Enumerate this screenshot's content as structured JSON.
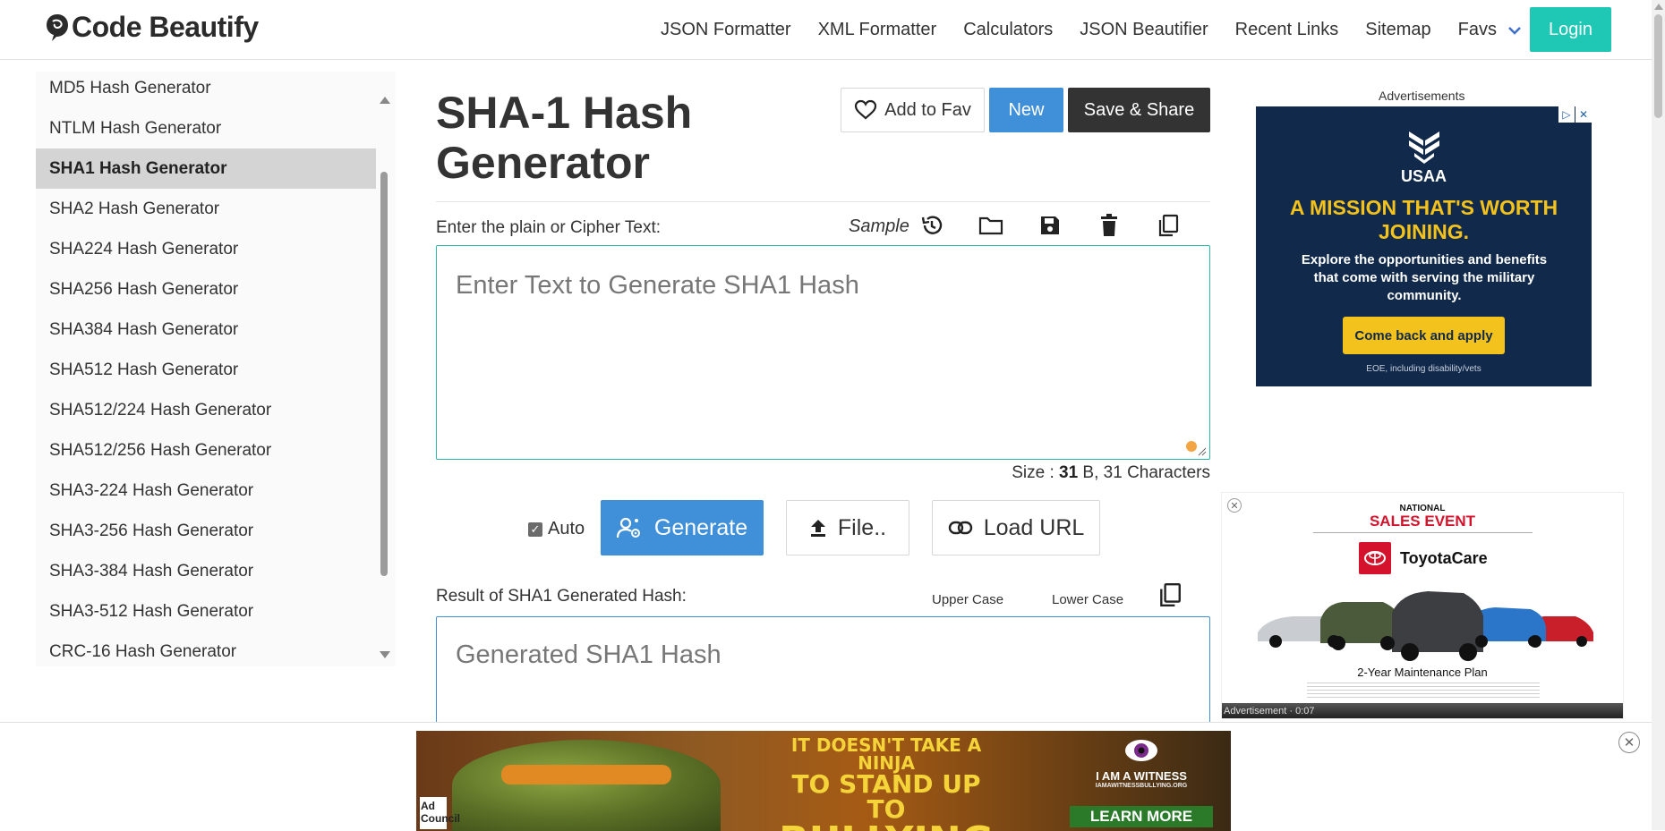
{
  "header": {
    "logo_text": "Code Beautify",
    "nav": [
      "JSON Formatter",
      "XML Formatter",
      "Calculators",
      "JSON Beautifier",
      "Recent Links",
      "Sitemap"
    ],
    "favs_label": "Favs",
    "login_label": "Login"
  },
  "sidebar": {
    "items": [
      {
        "label": "MD5 Hash Generator",
        "active": false
      },
      {
        "label": "NTLM Hash Generator",
        "active": false
      },
      {
        "label": "SHA1 Hash Generator",
        "active": true
      },
      {
        "label": "SHA2 Hash Generator",
        "active": false
      },
      {
        "label": "SHA224 Hash Generator",
        "active": false
      },
      {
        "label": "SHA256 Hash Generator",
        "active": false
      },
      {
        "label": "SHA384 Hash Generator",
        "active": false
      },
      {
        "label": "SHA512 Hash Generator",
        "active": false
      },
      {
        "label": "SHA512/224 Hash Generator",
        "active": false
      },
      {
        "label": "SHA512/256 Hash Generator",
        "active": false
      },
      {
        "label": "SHA3-224 Hash Generator",
        "active": false
      },
      {
        "label": "SHA3-256 Hash Generator",
        "active": false
      },
      {
        "label": "SHA3-384 Hash Generator",
        "active": false
      },
      {
        "label": "SHA3-512 Hash Generator",
        "active": false
      },
      {
        "label": "CRC-16 Hash Generator",
        "active": false
      }
    ]
  },
  "main": {
    "title": "SHA-1 Hash Generator",
    "add_fav_label": "Add to Fav",
    "new_label": "New",
    "save_share_label": "Save & Share",
    "input_label": "Enter the plain or Cipher Text:",
    "sample_label": "Sample",
    "input_placeholder": "Enter Text to Generate SHA1 Hash",
    "size_prefix": "Size : ",
    "size_bytes": "31",
    "size_suffix": " B, 31 Characters",
    "auto_label": "Auto",
    "auto_checked": true,
    "generate_label": "Generate",
    "file_label": "File..",
    "load_url_label": "Load URL",
    "result_label": "Result of SHA1 Generated Hash:",
    "upper_case_label": "Upper Case",
    "lower_case_label": "Lower Case",
    "result_placeholder": "Generated SHA1 Hash"
  },
  "ads": {
    "label": "Advertisements",
    "usaa": {
      "brand": "USAA",
      "headline": "A MISSION THAT'S WORTH JOINING.",
      "body": "Explore the opportunities and benefits that come with serving the military community.",
      "cta": "Come back and apply",
      "footnote": "EOE, including disability/vets"
    },
    "toyota": {
      "line1": "NATIONAL",
      "line2": "SALES EVENT",
      "brand": "ToyotaCare",
      "plan": "2-Year Maintenance Plan",
      "timer": "Advertisement · 0:07"
    },
    "banner": {
      "adchoices": "Ad Council",
      "slogan_1": "IT doesn't TAKE a NINJA",
      "slogan_2": "to STAND UP to",
      "slogan_3": "BULLYING",
      "witness_1": "I AM A WITNESS",
      "witness_2": "IAMAWITNESSBULLYING.ORG",
      "learn_more": "LEARN MORE"
    }
  },
  "colors": {
    "accent_teal": "#1ec8b4",
    "primary_blue": "#3f8fd9",
    "dark_button": "#333333",
    "active_sidebar": "#d4d4d4"
  }
}
